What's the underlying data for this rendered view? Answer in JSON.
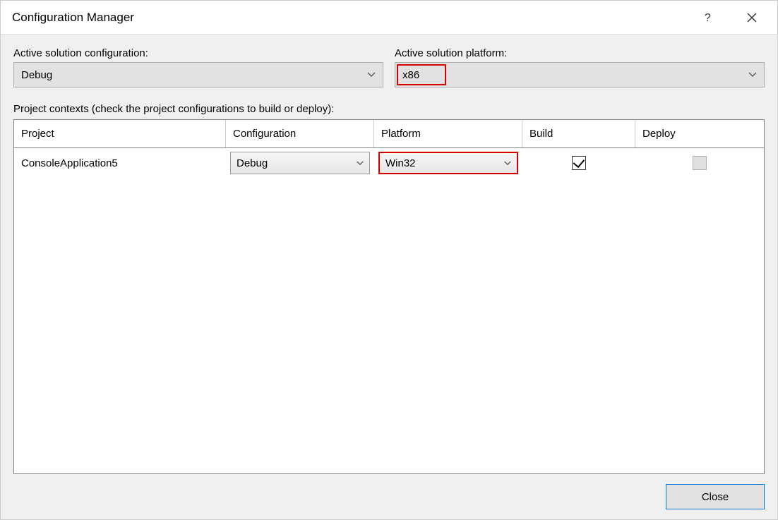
{
  "window": {
    "title": "Configuration Manager"
  },
  "labels": {
    "active_config": "Active solution configuration:",
    "active_platform": "Active solution platform:",
    "contexts": "Project contexts (check the project configurations to build or deploy):"
  },
  "selectors": {
    "active_config_value": "Debug",
    "active_platform_value": "x86"
  },
  "grid": {
    "headers": {
      "project": "Project",
      "configuration": "Configuration",
      "platform": "Platform",
      "build": "Build",
      "deploy": "Deploy"
    },
    "rows": [
      {
        "project": "ConsoleApplication5",
        "configuration": "Debug",
        "platform": "Win32",
        "build": true,
        "deploy_enabled": false
      }
    ]
  },
  "buttons": {
    "close": "Close"
  }
}
